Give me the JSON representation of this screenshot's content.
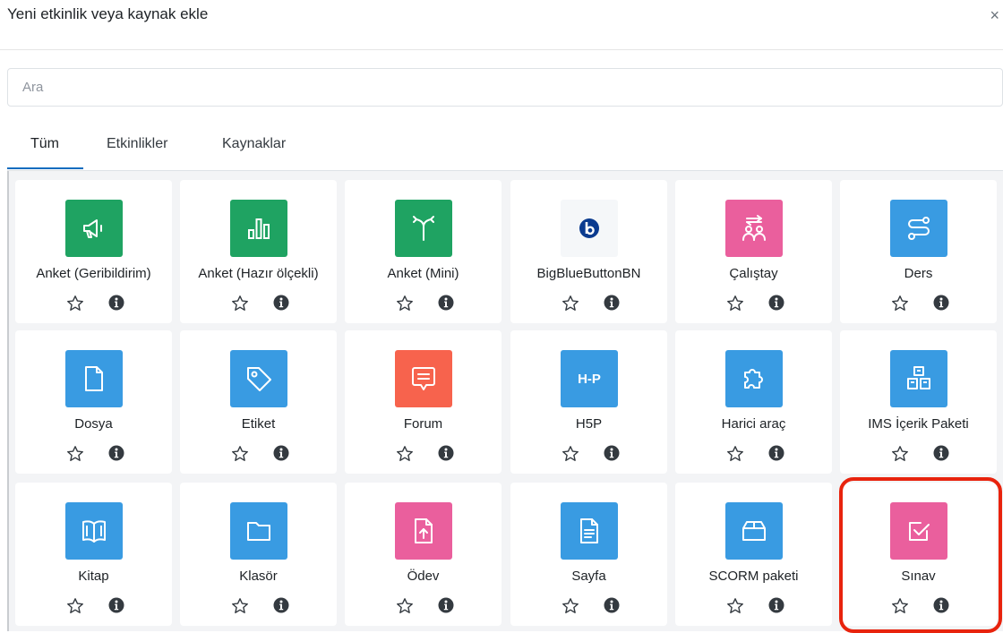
{
  "header": {
    "title": "Yeni etkinlik veya kaynak ekle",
    "close_label": "×"
  },
  "search": {
    "placeholder": "Ara",
    "value": ""
  },
  "tabs": [
    {
      "label": "Tüm",
      "active": true
    },
    {
      "label": "Etkinlikler",
      "active": false
    },
    {
      "label": "Kaynaklar",
      "active": false
    }
  ],
  "colors": {
    "green": "#1fa362",
    "pink": "#ea5f9d",
    "blue": "#399be2",
    "red": "#f7634d",
    "bbb_bg": "#f5f7f9",
    "bbb_circle": "#0b3b8f",
    "highlight": "#e8230d"
  },
  "modules": [
    {
      "label": "Anket (Geribildirim)",
      "icon": "megaphone-icon",
      "color": "green"
    },
    {
      "label": "Anket (Hazır ölçekli)",
      "icon": "bar-chart-icon",
      "color": "green"
    },
    {
      "label": "Anket (Mini)",
      "icon": "signpost-icon",
      "color": "green"
    },
    {
      "label": "BigBlueButtonBN",
      "icon": "bigbluebutton-icon",
      "color": "bbb_bg"
    },
    {
      "label": "Çalıştay",
      "icon": "people-exchange-icon",
      "color": "pink"
    },
    {
      "label": "Ders",
      "icon": "path-icon",
      "color": "blue"
    },
    {
      "label": "Dosya",
      "icon": "file-icon",
      "color": "blue"
    },
    {
      "label": "Etiket",
      "icon": "tag-icon",
      "color": "blue"
    },
    {
      "label": "Forum",
      "icon": "chat-icon",
      "color": "red"
    },
    {
      "label": "H5P",
      "icon": "h5p-icon",
      "color": "blue",
      "icon_text": "H-P"
    },
    {
      "label": "Harici araç",
      "icon": "puzzle-icon",
      "color": "blue"
    },
    {
      "label": "IMS İçerik Paketi",
      "icon": "boxes-icon",
      "color": "blue"
    },
    {
      "label": "Kitap",
      "icon": "book-icon",
      "color": "blue"
    },
    {
      "label": "Klasör",
      "icon": "folder-icon",
      "color": "blue"
    },
    {
      "label": "Ödev",
      "icon": "upload-file-icon",
      "color": "pink"
    },
    {
      "label": "Sayfa",
      "icon": "document-icon",
      "color": "blue"
    },
    {
      "label": "SCORM paketi",
      "icon": "package-icon",
      "color": "blue"
    },
    {
      "label": "Sınav",
      "icon": "checkbox-icon",
      "color": "pink"
    }
  ]
}
